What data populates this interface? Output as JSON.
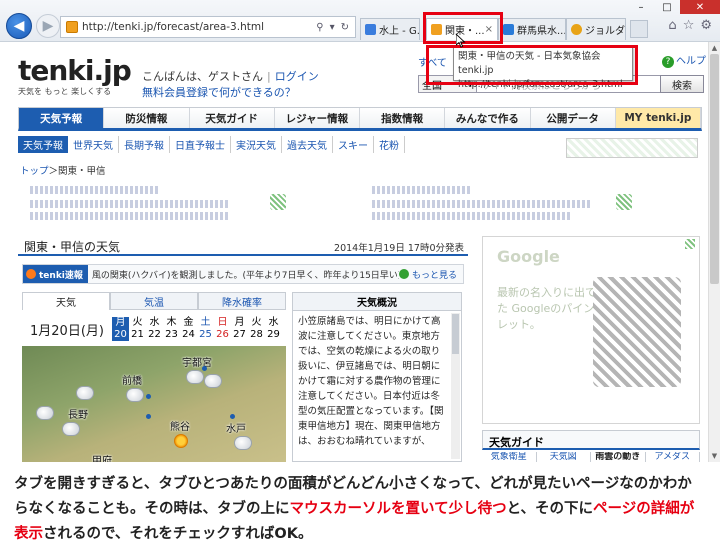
{
  "browser": {
    "url": "http://tenki.jp/forecast/area-3.html",
    "tabs": [
      {
        "label": "水上 - G...",
        "close": ""
      },
      {
        "label": "関東・...",
        "close": "×"
      },
      {
        "label": "群馬県水...",
        "close": ""
      },
      {
        "label": "ジョルダン...",
        "close": ""
      }
    ],
    "tooltip": {
      "line1": "関東・甲信の天気 - 日本気象協会 tenki.jp",
      "line2": "http://tenki.jp/forecast/area-3.html"
    },
    "window_controls": [
      "–",
      "□",
      "✕"
    ],
    "icons": [
      "home-icon",
      "star-icon",
      "gear-icon"
    ]
  },
  "site": {
    "logo": "tenki.jp",
    "tagline": "天気を もっと 楽しくする",
    "greeting": "こんばんは、ゲストさん",
    "login": "ログイン",
    "member_link": "無料会員登録で何ができるの？",
    "all_link": "すべて",
    "help_link": "ヘルプ",
    "search_scope": "全国",
    "search_placeholder": "サイト内検索はこちらから",
    "search_button": "検索"
  },
  "main_nav": [
    "天気予報",
    "防災情報",
    "天気ガイド",
    "レジャー情報",
    "指数情報",
    "みんなで作る",
    "公開データ",
    "MY tenki.jp"
  ],
  "sub_nav": [
    "天気予報",
    "世界天気",
    "長期予報",
    "日直予報士",
    "実況天気",
    "過去天気",
    "スキー",
    "花粉"
  ],
  "breadcrumb": {
    "home": "トップ",
    "sep": "＞",
    "current": "関東・甲信"
  },
  "forecast": {
    "title": "関東・甲信の天気",
    "issued": "2014年1月19日  17時0分発表",
    "flash_badge": "tenki速報",
    "flash_text": "風の関東(ハクバイ)を観測しました。(平年より7日早く、昨年より15日早い)(東京)",
    "flash_more": "もっと見る",
    "tabs": [
      "天気",
      "気温",
      "降水確率"
    ],
    "date_label": "1月20日(月)",
    "days": [
      {
        "dow": "月",
        "num": "20",
        "type": "sel"
      },
      {
        "dow": "火",
        "num": "21",
        "type": ""
      },
      {
        "dow": "水",
        "num": "22",
        "type": ""
      },
      {
        "dow": "木",
        "num": "23",
        "type": ""
      },
      {
        "dow": "金",
        "num": "24",
        "type": ""
      },
      {
        "dow": "土",
        "num": "25",
        "type": "sat"
      },
      {
        "dow": "日",
        "num": "26",
        "type": "sun"
      },
      {
        "dow": "月",
        "num": "27",
        "type": ""
      },
      {
        "dow": "火",
        "num": "28",
        "type": ""
      },
      {
        "dow": "水",
        "num": "29",
        "type": ""
      }
    ],
    "cities": [
      "宇都宮",
      "前橋",
      "長野",
      "熊谷",
      "水戸",
      "甲府"
    ],
    "overview_title": "天気概況",
    "overview_text": "小笠原諸島では、明日にかけて高波に注意してください。東京地方では、空気の乾燥による火の取り扱いに、伊豆諸島では、明日朝にかけて霜に対する農作物の管理に注意してください。日本付近は冬型の気圧配置となっています。【関東甲信地方】現在、関東甲信地方は、おおむね晴れていますが、"
  },
  "sidebar": {
    "ad_brand": "Google",
    "ad_text": "最新の名入りに出てきた Googleのパインタブレット。",
    "guide_title": "天気ガイド",
    "guide_tabs": [
      "気象衛星",
      "天気図",
      "雨雲の動き",
      "アメダス"
    ]
  },
  "caption": {
    "part1": "タブを開きすぎると、タブひとつあたりの面積がどんどん小さくなって、どれが見たいページなのかわからなくなることも。その時は、タブの上に",
    "highlight1": "マウスカーソルを置いて少し待つ",
    "part2": "と、その下に",
    "highlight2": "ページの詳細が表示",
    "part3": "されるので、それをチェックすればOK。"
  },
  "colors": {
    "accent": "#1d5db0",
    "highlight": "#e60012"
  }
}
